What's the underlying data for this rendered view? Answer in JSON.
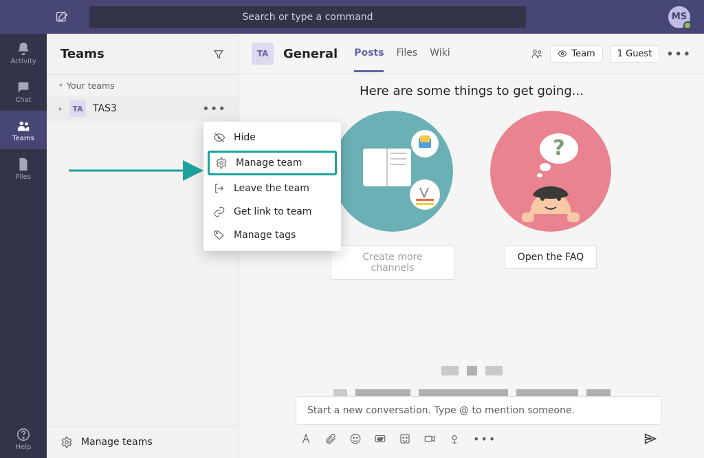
{
  "top": {
    "search_placeholder": "Search or type a command",
    "avatar_initials": "MS"
  },
  "rail": {
    "items": [
      {
        "label": "Activity"
      },
      {
        "label": "Chat"
      },
      {
        "label": "Teams"
      },
      {
        "label": "Files"
      }
    ],
    "help_label": "Help"
  },
  "teams": {
    "title": "Teams",
    "section_label": "Your teams",
    "team": {
      "avatar": "TA",
      "name": "TAS3"
    },
    "manage_teams_label": "Manage teams"
  },
  "ctx": {
    "items": [
      {
        "label": "Hide"
      },
      {
        "label": "Manage team"
      },
      {
        "label": "Leave the team"
      },
      {
        "label": "Get link to team"
      },
      {
        "label": "Manage tags"
      }
    ]
  },
  "channel": {
    "avatar": "TA",
    "name": "General",
    "tabs": [
      {
        "label": "Posts"
      },
      {
        "label": "Files"
      },
      {
        "label": "Wiki"
      }
    ],
    "visibility_label": "Team",
    "guest_label": "1 Guest"
  },
  "intro": {
    "headline": "Here are some things to get going...",
    "card1_btn": "Create more channels",
    "card2_btn": "Open the FAQ"
  },
  "composer": {
    "placeholder": "Start a new conversation. Type @ to mention someone."
  }
}
